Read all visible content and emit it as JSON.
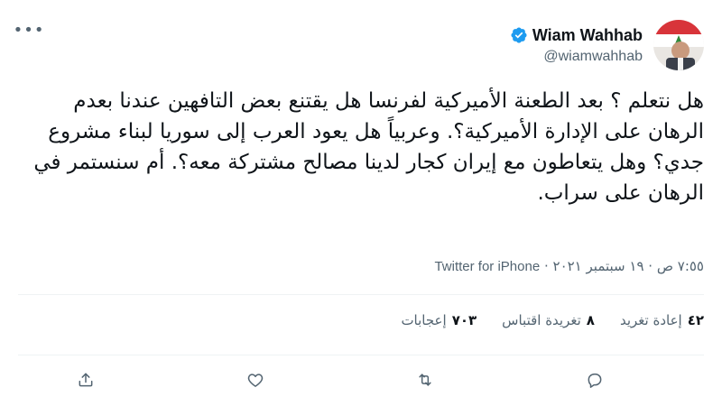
{
  "tweet": {
    "author": {
      "display_name": "Wiam Wahhab",
      "handle": "@wiamwahhab",
      "verified": true,
      "avatar_icon": "avatar-photo"
    },
    "text": "هل نتعلم ؟ بعد الطعنة الأميركية لفرنسا هل يقتنع بعض التافهين عندنا بعدم الرهان على الإدارة الأميركية؟. وعربياً هل يعود العرب إلى سوريا لبناء مشروع جدي؟ وهل يتعاطون مع إيران كجار لدينا مصالح مشتركة معه؟. أم سنستمر في الرهان على سراب.",
    "meta": {
      "time": "٧:٥٥ ص",
      "separator": "·",
      "date": "١٩ سبتمبر ٢٠٢١",
      "source": "Twitter for iPhone"
    },
    "stats": [
      {
        "num": "٤٢",
        "label": "إعادة تغريد"
      },
      {
        "num": "٨",
        "label": "تغريدة اقتباس"
      },
      {
        "num": "٧٠٣",
        "label": "إعجابات"
      }
    ],
    "actions": [
      "reply-icon",
      "retweet-icon",
      "like-icon",
      "share-icon"
    ]
  },
  "colors": {
    "text": "#0f1419",
    "secondary": "#536471",
    "verified": "#1d9bf0",
    "divider": "#eff3f4"
  }
}
